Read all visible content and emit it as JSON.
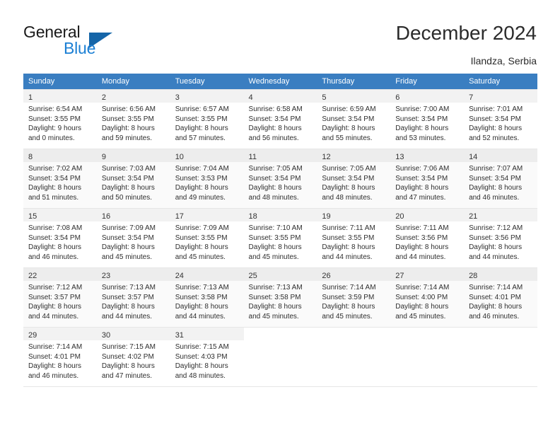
{
  "brand": {
    "name_part1": "General",
    "name_part2": "Blue",
    "triangle_icon": "triangle-icon",
    "accent_color": "#1b7fd4",
    "triangle_color": "#1565a8"
  },
  "header": {
    "title": "December 2024",
    "subtitle": "Ilandza, Serbia"
  },
  "calendar": {
    "header_bg": "#3a7ec1",
    "weekdays": [
      "Sunday",
      "Monday",
      "Tuesday",
      "Wednesday",
      "Thursday",
      "Friday",
      "Saturday"
    ],
    "weeks": [
      [
        {
          "day": "1",
          "details": "Sunrise: 6:54 AM\nSunset: 3:55 PM\nDaylight: 9 hours\nand 0 minutes."
        },
        {
          "day": "2",
          "details": "Sunrise: 6:56 AM\nSunset: 3:55 PM\nDaylight: 8 hours\nand 59 minutes."
        },
        {
          "day": "3",
          "details": "Sunrise: 6:57 AM\nSunset: 3:55 PM\nDaylight: 8 hours\nand 57 minutes."
        },
        {
          "day": "4",
          "details": "Sunrise: 6:58 AM\nSunset: 3:54 PM\nDaylight: 8 hours\nand 56 minutes."
        },
        {
          "day": "5",
          "details": "Sunrise: 6:59 AM\nSunset: 3:54 PM\nDaylight: 8 hours\nand 55 minutes."
        },
        {
          "day": "6",
          "details": "Sunrise: 7:00 AM\nSunset: 3:54 PM\nDaylight: 8 hours\nand 53 minutes."
        },
        {
          "day": "7",
          "details": "Sunrise: 7:01 AM\nSunset: 3:54 PM\nDaylight: 8 hours\nand 52 minutes."
        }
      ],
      [
        {
          "day": "8",
          "details": "Sunrise: 7:02 AM\nSunset: 3:54 PM\nDaylight: 8 hours\nand 51 minutes."
        },
        {
          "day": "9",
          "details": "Sunrise: 7:03 AM\nSunset: 3:54 PM\nDaylight: 8 hours\nand 50 minutes."
        },
        {
          "day": "10",
          "details": "Sunrise: 7:04 AM\nSunset: 3:53 PM\nDaylight: 8 hours\nand 49 minutes."
        },
        {
          "day": "11",
          "details": "Sunrise: 7:05 AM\nSunset: 3:54 PM\nDaylight: 8 hours\nand 48 minutes."
        },
        {
          "day": "12",
          "details": "Sunrise: 7:05 AM\nSunset: 3:54 PM\nDaylight: 8 hours\nand 48 minutes."
        },
        {
          "day": "13",
          "details": "Sunrise: 7:06 AM\nSunset: 3:54 PM\nDaylight: 8 hours\nand 47 minutes."
        },
        {
          "day": "14",
          "details": "Sunrise: 7:07 AM\nSunset: 3:54 PM\nDaylight: 8 hours\nand 46 minutes."
        }
      ],
      [
        {
          "day": "15",
          "details": "Sunrise: 7:08 AM\nSunset: 3:54 PM\nDaylight: 8 hours\nand 46 minutes."
        },
        {
          "day": "16",
          "details": "Sunrise: 7:09 AM\nSunset: 3:54 PM\nDaylight: 8 hours\nand 45 minutes."
        },
        {
          "day": "17",
          "details": "Sunrise: 7:09 AM\nSunset: 3:55 PM\nDaylight: 8 hours\nand 45 minutes."
        },
        {
          "day": "18",
          "details": "Sunrise: 7:10 AM\nSunset: 3:55 PM\nDaylight: 8 hours\nand 45 minutes."
        },
        {
          "day": "19",
          "details": "Sunrise: 7:11 AM\nSunset: 3:55 PM\nDaylight: 8 hours\nand 44 minutes."
        },
        {
          "day": "20",
          "details": "Sunrise: 7:11 AM\nSunset: 3:56 PM\nDaylight: 8 hours\nand 44 minutes."
        },
        {
          "day": "21",
          "details": "Sunrise: 7:12 AM\nSunset: 3:56 PM\nDaylight: 8 hours\nand 44 minutes."
        }
      ],
      [
        {
          "day": "22",
          "details": "Sunrise: 7:12 AM\nSunset: 3:57 PM\nDaylight: 8 hours\nand 44 minutes."
        },
        {
          "day": "23",
          "details": "Sunrise: 7:13 AM\nSunset: 3:57 PM\nDaylight: 8 hours\nand 44 minutes."
        },
        {
          "day": "24",
          "details": "Sunrise: 7:13 AM\nSunset: 3:58 PM\nDaylight: 8 hours\nand 44 minutes."
        },
        {
          "day": "25",
          "details": "Sunrise: 7:13 AM\nSunset: 3:58 PM\nDaylight: 8 hours\nand 45 minutes."
        },
        {
          "day": "26",
          "details": "Sunrise: 7:14 AM\nSunset: 3:59 PM\nDaylight: 8 hours\nand 45 minutes."
        },
        {
          "day": "27",
          "details": "Sunrise: 7:14 AM\nSunset: 4:00 PM\nDaylight: 8 hours\nand 45 minutes."
        },
        {
          "day": "28",
          "details": "Sunrise: 7:14 AM\nSunset: 4:01 PM\nDaylight: 8 hours\nand 46 minutes."
        }
      ],
      [
        {
          "day": "29",
          "details": "Sunrise: 7:14 AM\nSunset: 4:01 PM\nDaylight: 8 hours\nand 46 minutes."
        },
        {
          "day": "30",
          "details": "Sunrise: 7:15 AM\nSunset: 4:02 PM\nDaylight: 8 hours\nand 47 minutes."
        },
        {
          "day": "31",
          "details": "Sunrise: 7:15 AM\nSunset: 4:03 PM\nDaylight: 8 hours\nand 48 minutes."
        },
        {
          "day": "",
          "details": ""
        },
        {
          "day": "",
          "details": ""
        },
        {
          "day": "",
          "details": ""
        },
        {
          "day": "",
          "details": ""
        }
      ]
    ]
  }
}
